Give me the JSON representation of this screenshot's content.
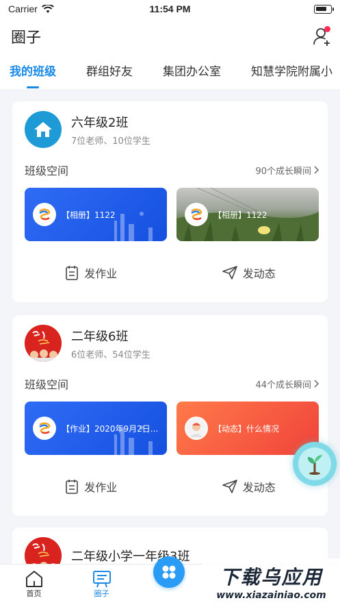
{
  "status_bar": {
    "carrier": "Carrier",
    "time": "11:54 PM"
  },
  "header": {
    "title": "圈子"
  },
  "tabs": [
    {
      "label": "我的班级",
      "active": true
    },
    {
      "label": "群组好友",
      "active": false
    },
    {
      "label": "集团办公室",
      "active": false
    },
    {
      "label": "知慧学院附属小",
      "active": false
    }
  ],
  "cards": [
    {
      "class_name": "六年级2班",
      "meta": "7位老师、10位学生",
      "space_label": "班级空间",
      "space_link": "90个成长瞬间",
      "tiles": [
        {
          "text": "【相册】1122",
          "style": "blue"
        },
        {
          "text": "【相册】1122",
          "style": "photo"
        }
      ],
      "actions": {
        "homework": "发作业",
        "post": "发动态"
      }
    },
    {
      "class_name": "二年级6班",
      "meta": "6位老师、54位学生",
      "space_label": "班级空间",
      "space_link": "44个成长瞬间",
      "tiles": [
        {
          "text": "【作业】2020年9月2日...",
          "style": "blue"
        },
        {
          "text": "【动态】什么情况",
          "style": "red"
        }
      ],
      "actions": {
        "homework": "发作业",
        "post": "发动态"
      }
    },
    {
      "class_name": "二年级小学一年级3班",
      "meta": ""
    }
  ],
  "tabbar": {
    "home": "首页",
    "circle": "圈子"
  },
  "watermark": {
    "main": "下载乌应用",
    "url": "www.xiazainiao.com"
  },
  "colors": {
    "accent": "#1a8ae8",
    "notify": "#ff2d55",
    "tile_blue": "#2f6cf5",
    "tile_red": "#f0433a"
  }
}
